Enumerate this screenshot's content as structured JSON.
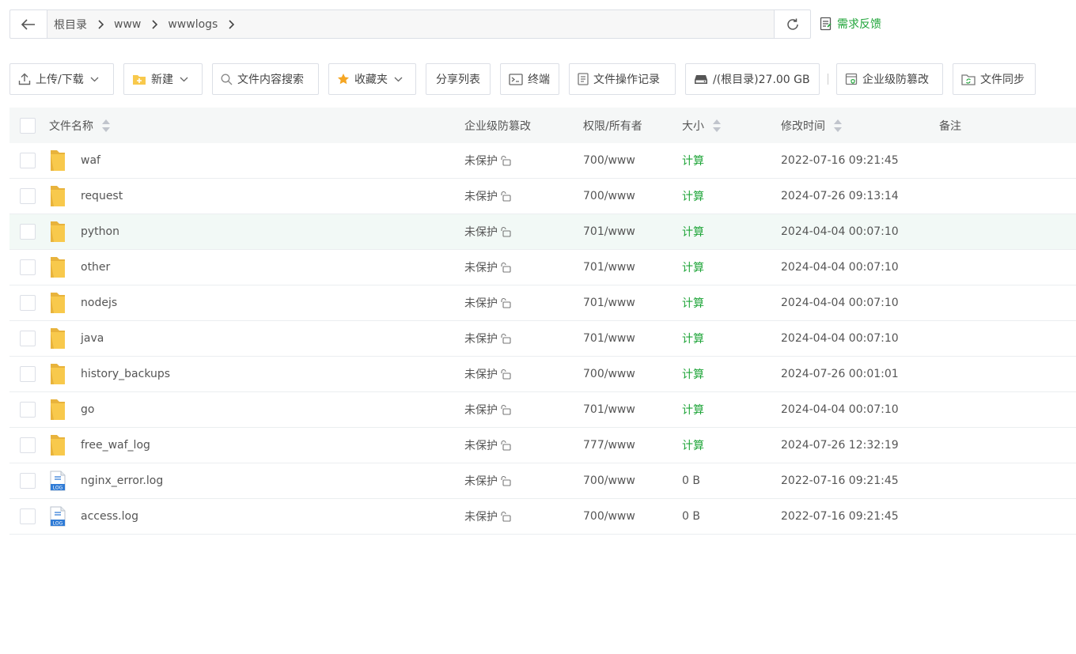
{
  "breadcrumb": {
    "items": [
      "根目录",
      "www",
      "wwwlogs"
    ]
  },
  "feedback": {
    "label": "需求反馈"
  },
  "toolbar": {
    "upload_label": "上传/下载",
    "new_label": "新建",
    "search_label": "文件内容搜索",
    "favorites_label": "收藏夹",
    "share_label": "分享列表",
    "terminal_label": "终端",
    "log_label": "文件操作记录",
    "disk_label": "/(根目录)27.00 GB",
    "tamper_label": "企业级防篡改",
    "sync_label": "文件同步"
  },
  "columns": {
    "name": "文件名称",
    "protect": "企业级防篡改",
    "perm": "权限/所有者",
    "size": "大小",
    "mtime": "修改时间",
    "note": "备注"
  },
  "rows": [
    {
      "name": "waf",
      "type": "folder",
      "protect": "未保护",
      "perm": "700/www",
      "size": "计算",
      "mtime": "2022-07-16 09:21:45"
    },
    {
      "name": "request",
      "type": "folder",
      "protect": "未保护",
      "perm": "700/www",
      "size": "计算",
      "mtime": "2024-07-26 09:13:14"
    },
    {
      "name": "python",
      "type": "folder",
      "protect": "未保护",
      "perm": "701/www",
      "size": "计算",
      "mtime": "2024-04-04 00:07:10"
    },
    {
      "name": "other",
      "type": "folder",
      "protect": "未保护",
      "perm": "701/www",
      "size": "计算",
      "mtime": "2024-04-04 00:07:10"
    },
    {
      "name": "nodejs",
      "type": "folder",
      "protect": "未保护",
      "perm": "701/www",
      "size": "计算",
      "mtime": "2024-04-04 00:07:10"
    },
    {
      "name": "java",
      "type": "folder",
      "protect": "未保护",
      "perm": "701/www",
      "size": "计算",
      "mtime": "2024-04-04 00:07:10"
    },
    {
      "name": "history_backups",
      "type": "folder",
      "protect": "未保护",
      "perm": "700/www",
      "size": "计算",
      "mtime": "2024-07-26 00:01:01"
    },
    {
      "name": "go",
      "type": "folder",
      "protect": "未保护",
      "perm": "701/www",
      "size": "计算",
      "mtime": "2024-04-04 00:07:10"
    },
    {
      "name": "free_waf_log",
      "type": "folder",
      "protect": "未保护",
      "perm": "777/www",
      "size": "计算",
      "mtime": "2024-07-26 12:32:19"
    },
    {
      "name": "nginx_error.log",
      "type": "log",
      "protect": "未保护",
      "perm": "700/www",
      "size": "0 B",
      "mtime": "2022-07-16 09:21:45"
    },
    {
      "name": "access.log",
      "type": "log",
      "protect": "未保护",
      "perm": "700/www",
      "size": "0 B",
      "mtime": "2022-07-16 09:21:45"
    }
  ],
  "colors": {
    "accent": "#20a53a",
    "folder": "#f8c94c",
    "hover_row": "#f2f9f6"
  }
}
